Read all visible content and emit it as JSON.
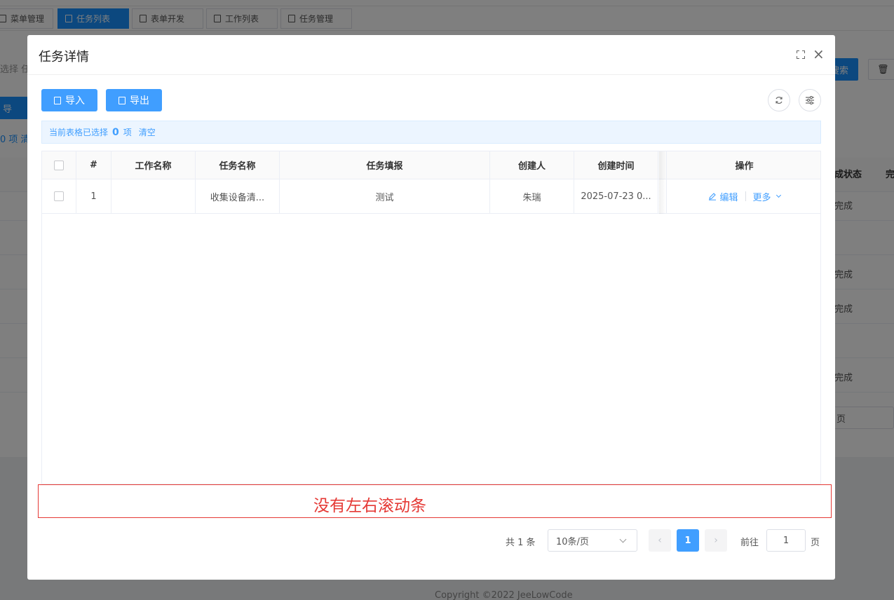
{
  "background": {
    "tabs": [
      {
        "label": "菜单管理",
        "active": false
      },
      {
        "label": "任务列表",
        "active": true
      },
      {
        "label": "表单开发",
        "active": false
      },
      {
        "label": "工作列表",
        "active": false
      },
      {
        "label": "任务管理",
        "active": false
      }
    ],
    "search_prefix": "选择 任",
    "search_button": "搜索",
    "import_button": "导",
    "selected_info": "0 项 清",
    "status_header": "成状态",
    "status_header2": "完",
    "status_values": [
      "完成",
      "完成",
      "完成",
      "完成"
    ],
    "pager_text": "页",
    "footer": "Copyright ©2022 JeeLowCode"
  },
  "modal": {
    "title": "任务详情",
    "import_label": "导入",
    "export_label": "导出",
    "selection": {
      "prefix": "当前表格已选择",
      "count": "0",
      "suffix": "项",
      "clear": "清空"
    },
    "table": {
      "headers": [
        "#",
        "工作名称",
        "任务名称",
        "任务填报",
        "创建人",
        "创建时间",
        "操作"
      ],
      "rows": [
        {
          "index": "1",
          "work_name": "",
          "task_name": "收集设备清...",
          "task_fill": "测试",
          "creator": "朱瑞",
          "created_at": "2025-07-23 0...",
          "edit": "编辑",
          "more": "更多"
        }
      ]
    },
    "annotation": "没有左右滚动条",
    "pagination": {
      "total": "共 1 条",
      "page_size": "10条/页",
      "current": "1",
      "goto_label": "前往",
      "goto_value": "1",
      "page_suffix": "页"
    }
  },
  "colors": {
    "primary": "#409eff",
    "annotation": "#e53935"
  }
}
